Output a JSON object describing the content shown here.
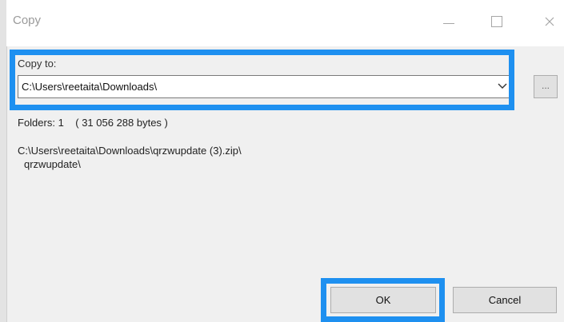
{
  "window": {
    "title": "Copy"
  },
  "copy_to": {
    "label": "Copy to:",
    "path_value": "C:\\Users\\reetaita\\Downloads\\",
    "browse_label": "..."
  },
  "info": {
    "folders": "Folders: 1    ( 31 056 288 bytes )",
    "source_path": "C:\\Users\\reetaita\\Downloads\\qrzwupdate (3).zip\\",
    "source_sub": "qrzwupdate\\"
  },
  "buttons": {
    "ok": "OK",
    "cancel": "Cancel"
  },
  "colors": {
    "highlight": "#1e90f0"
  },
  "icons": {
    "minimize": "minimize-icon",
    "maximize": "maximize-icon",
    "close": "close-icon",
    "dropdown": "chevron-down-icon"
  }
}
